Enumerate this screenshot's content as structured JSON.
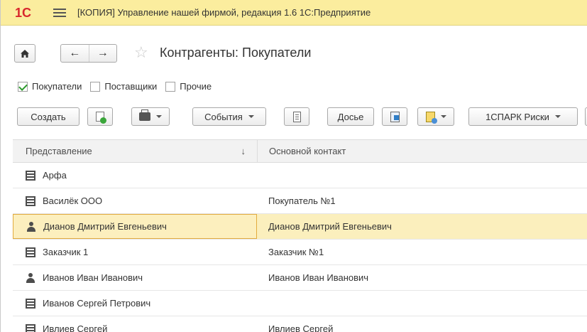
{
  "window": {
    "title": "[КОПИЯ] Управление нашей фирмой, редакция 1.6 1С:Предприятие",
    "logo_text": "1С"
  },
  "nav": {
    "back_glyph": "←",
    "forward_glyph": "→",
    "star_glyph": "☆",
    "page_title": "Контрагенты: Покупатели"
  },
  "filters": [
    {
      "label": "Покупатели",
      "checked": true
    },
    {
      "label": "Поставщики",
      "checked": false
    },
    {
      "label": "Прочие",
      "checked": false
    }
  ],
  "toolbar": {
    "create_label": "Создать",
    "events_label": "События",
    "dossier_label": "Досье",
    "spark_label": "1СПАРК Риски"
  },
  "table": {
    "headers": {
      "col1": "Представление",
      "col2": "Основной контакт",
      "sort_glyph": "↓"
    },
    "rows": [
      {
        "icon": "organization-icon",
        "name": "Арфа",
        "contact": ""
      },
      {
        "icon": "organization-icon",
        "name": "Василёк ООО",
        "contact": "Покупатель №1"
      },
      {
        "icon": "person-icon",
        "name": "Дианов Дмитрий Евгеньевич",
        "contact": "Дианов Дмитрий Евгеньевич",
        "selected": true
      },
      {
        "icon": "organization-icon",
        "name": "Заказчик 1",
        "contact": "Заказчик №1"
      },
      {
        "icon": "person-icon",
        "name": "Иванов Иван Иванович",
        "contact": "Иванов Иван Иванович"
      },
      {
        "icon": "organization-icon",
        "name": "Иванов Сергей Петрович",
        "contact": ""
      },
      {
        "icon": "organization-icon",
        "name": "Ивлиев Сергей",
        "contact": "Ивлиев Сергей"
      }
    ]
  },
  "colors": {
    "titlebar_bg": "#fbed9e",
    "selected_row_bg": "#fbefbd",
    "logo_red": "#d8282d",
    "check_green": "#2e9b2e"
  }
}
